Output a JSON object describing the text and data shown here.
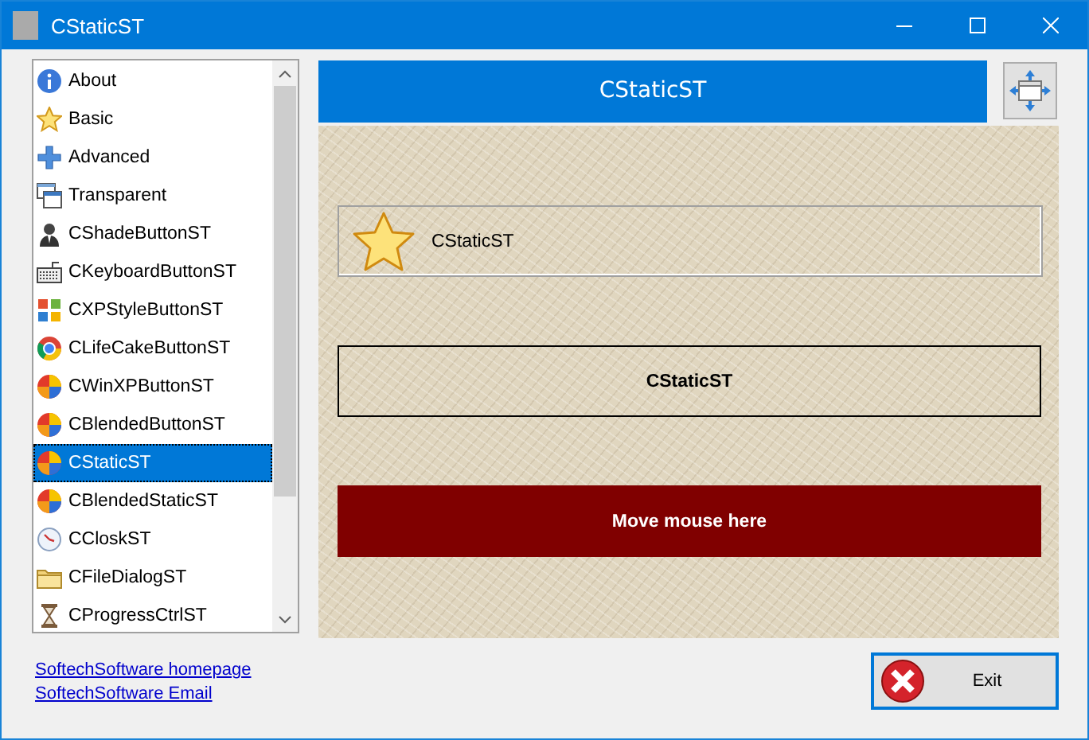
{
  "window": {
    "title": "CStaticST"
  },
  "list": {
    "items": [
      {
        "label": "About",
        "kind": "info",
        "selected": false
      },
      {
        "label": "Basic",
        "kind": "star",
        "selected": false
      },
      {
        "label": "Advanced",
        "kind": "plus",
        "selected": false
      },
      {
        "label": "Transparent",
        "kind": "windows",
        "selected": false
      },
      {
        "label": "CShadeButtonST",
        "kind": "person",
        "selected": false
      },
      {
        "label": "CKeyboardButtonST",
        "kind": "keyboard",
        "selected": false
      },
      {
        "label": "CXPStyleButtonST",
        "kind": "tiles",
        "selected": false
      },
      {
        "label": "CLifeCakeButtonST",
        "kind": "ring",
        "selected": false
      },
      {
        "label": "CWinXPButtonST",
        "kind": "ball",
        "selected": false
      },
      {
        "label": "CBlendedButtonST",
        "kind": "ball",
        "selected": false
      },
      {
        "label": "CStaticST",
        "kind": "ball",
        "selected": true
      },
      {
        "label": "CBlendedStaticST",
        "kind": "ball",
        "selected": false
      },
      {
        "label": "CCloskST",
        "kind": "clock",
        "selected": false
      },
      {
        "label": "CFileDialogST",
        "kind": "folder",
        "selected": false
      },
      {
        "label": "CProgressCtrlST",
        "kind": "hourglass",
        "selected": false
      }
    ]
  },
  "links": [
    "SoftechSoftware homepage",
    "SoftechSoftware Email"
  ],
  "header": {
    "title": "CStaticST"
  },
  "statics": [
    {
      "kind": "icon",
      "text": "CStaticST"
    },
    {
      "kind": "framed",
      "text": "CStaticST"
    },
    {
      "kind": "filled",
      "text": "Move mouse here"
    }
  ],
  "exit_button": {
    "label": "Exit"
  }
}
